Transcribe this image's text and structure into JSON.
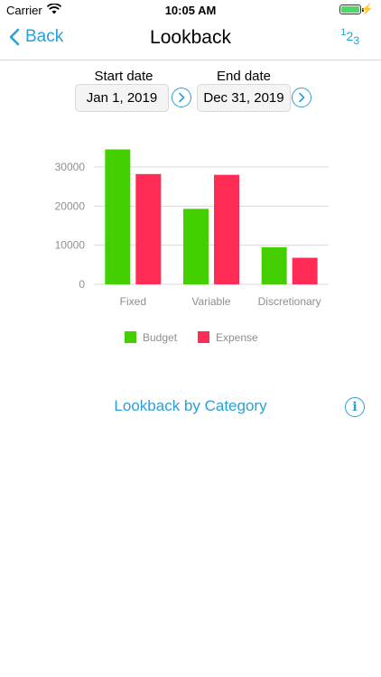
{
  "status_bar": {
    "carrier": "Carrier",
    "time": "10:05 AM",
    "battery_level": 1.0
  },
  "nav": {
    "back_label": "Back",
    "title": "Lookback",
    "sort_icon": "123-sort-icon"
  },
  "dates": {
    "start_label": "Start date",
    "start_value": "Jan 1, 2019",
    "end_label": "End date",
    "end_value": "Dec 31, 2019"
  },
  "chart_data": {
    "type": "bar",
    "categories": [
      "Fixed",
      "Variable",
      "Discretionary"
    ],
    "series": [
      {
        "name": "Budget",
        "values": [
          34500,
          19300,
          9500
        ],
        "color": "#44d000"
      },
      {
        "name": "Expense",
        "values": [
          28200,
          28000,
          6800
        ],
        "color": "#ff2d55"
      }
    ],
    "yticks": [
      0,
      10000,
      20000,
      30000
    ],
    "ylim": [
      0,
      30000
    ],
    "legend": "bottom"
  },
  "links": {
    "lookback_by_category": "Lookback by Category"
  },
  "colors": {
    "accent": "#2a9fd6"
  }
}
